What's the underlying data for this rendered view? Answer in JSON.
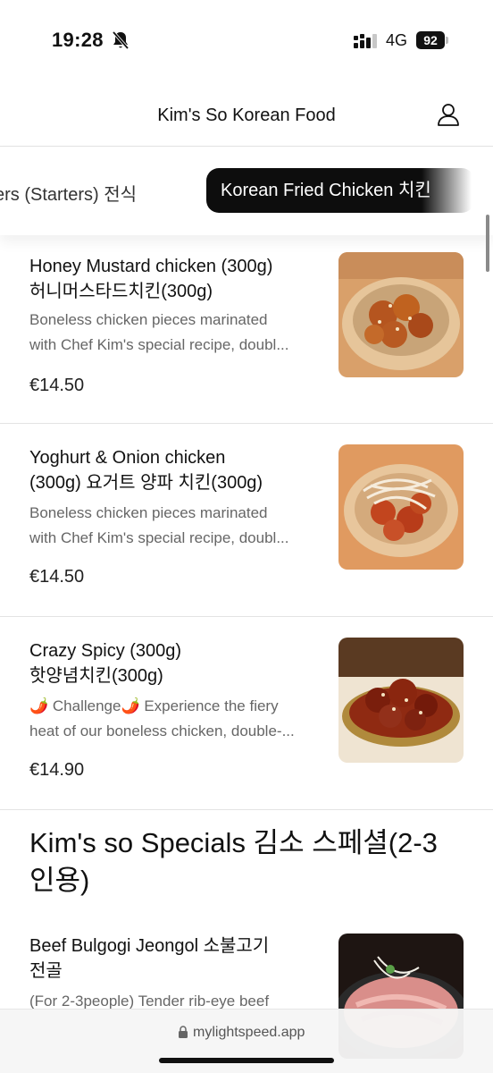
{
  "status_bar": {
    "time": "19:28",
    "network": "4G",
    "battery": "92"
  },
  "header": {
    "title": "Kim's So Korean Food"
  },
  "categories": {
    "previous": "ers (Starters) 전식",
    "active": "Korean Fried Chicken 치킨"
  },
  "items": [
    {
      "name_line1": "Honey Mustard chicken (300g)",
      "name_line2": "허니머스타드치킨(300g)",
      "desc_line1": "Boneless chicken pieces marinated",
      "desc_line2": "with Chef Kim's special recipe, doubl...",
      "price": "€14.50"
    },
    {
      "name_line1": "Yoghurt & Onion chicken",
      "name_line2": "(300g) 요거트 양파 치킨(300g)",
      "desc_line1": "Boneless chicken pieces marinated",
      "desc_line2": "with Chef Kim's special recipe, doubl...",
      "price": "€14.50"
    },
    {
      "name_line1": "Crazy Spicy (300g)",
      "name_line2": "핫양념치킨(300g)",
      "desc_line1": "🌶️ Challenge🌶️ Experience the fiery",
      "desc_line2": "heat of our boneless chicken, double-...",
      "price": "€14.90"
    }
  ],
  "section": {
    "title_line1": "Kim's so Specials 김소 스페셜(2-3",
    "title_line2": "인용)"
  },
  "special_item": {
    "name_line1": "Beef Bulgogi Jeongol 소불고기",
    "name_line2": "전골",
    "desc_line1": "(For 2-3people) Tender rib-eye beef"
  },
  "browser": {
    "url": "mylightspeed.app"
  },
  "icons": {
    "bell": "bell-off-icon",
    "signal": "cellular-signal-icon",
    "battery": "battery-icon",
    "account": "user-account-icon",
    "lock": "lock-icon"
  }
}
